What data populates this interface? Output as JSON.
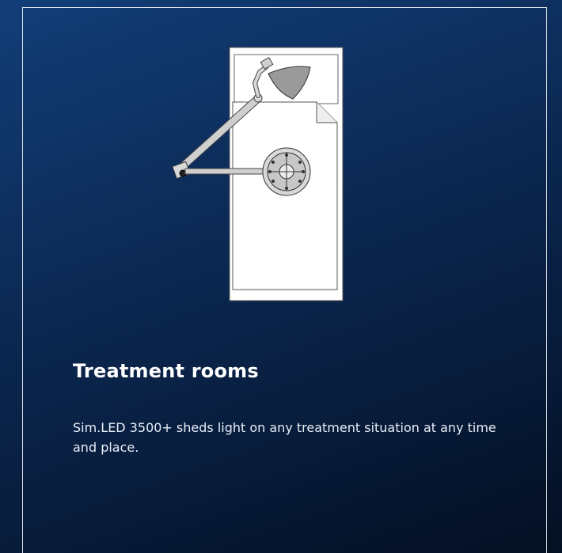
{
  "section": {
    "heading": "Treatment rooms",
    "description": "Sim.LED 3500+ sheds light on any treatment situation at any time and place."
  },
  "illustration": {
    "icon": "treatment-room-floorplan-illustration",
    "depicts": [
      "treatment-bed",
      "ceiling-lamp-arm",
      "lamp-head"
    ]
  },
  "colors": {
    "background_top": "#123e78",
    "background_bottom": "#040f22",
    "frame": "#ffffff",
    "text": "#ffffff"
  }
}
